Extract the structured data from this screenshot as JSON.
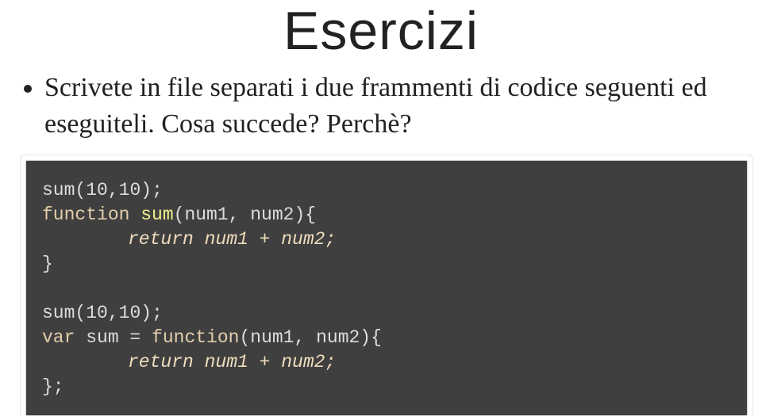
{
  "title": "Esercizi",
  "bullet": "Scrivete in file separati i due frammenti di codice seguenti ed eseguiteli. Cosa succede? Perchè?",
  "code": {
    "block1": {
      "l1_call": "sum",
      "l1_args_open": "(",
      "l1_arg1": "10",
      "l1_comma": ",",
      "l1_arg2": "10",
      "l1_close": ");",
      "l2_kw": "function",
      "l2_name": " sum",
      "l2_params": "(num1, num2){",
      "l3_ret": "return",
      "l3_expr": " num1 + num2;",
      "l4_close": "}"
    },
    "block2": {
      "l1_call": "sum",
      "l1_args_open": "(",
      "l1_arg1": "10",
      "l1_comma": ",",
      "l1_arg2": "10",
      "l1_close": ");",
      "l2_kw_var": "var",
      "l2_assign": " sum = ",
      "l2_kw_fn": "function",
      "l2_params": "(num1, num2){",
      "l3_ret": "return",
      "l3_expr": " num1 + num2;",
      "l4_close": "};"
    }
  }
}
